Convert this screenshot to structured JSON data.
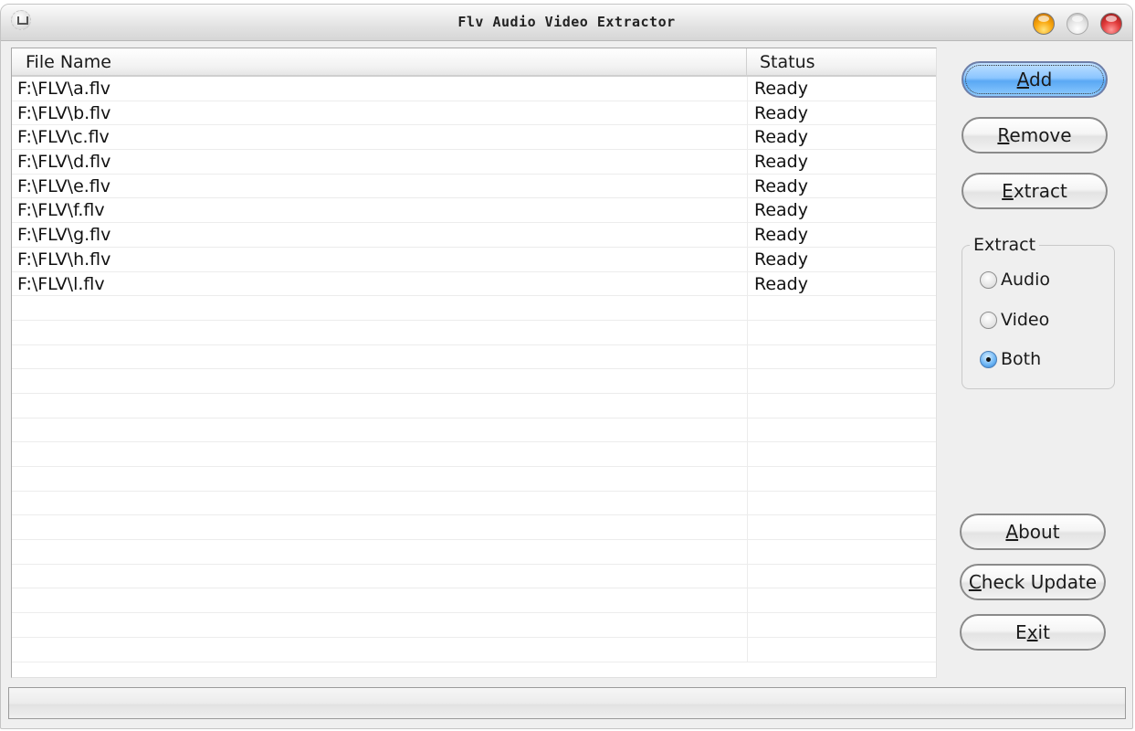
{
  "window": {
    "title": "Flv Audio Video Extractor",
    "icons": {
      "app": "app-icon",
      "minimize": "minimize-icon",
      "maximize": "maximize-icon",
      "close": "close-icon"
    },
    "colors": {
      "minimize": "#f9a70e",
      "maximize": "#e3e3e3",
      "close": "#e23c3c",
      "primary_button": "#8cc6ff"
    }
  },
  "file_list": {
    "columns": [
      "File Name",
      "Status"
    ],
    "rows": [
      {
        "name": "F:\\FLV\\a.flv",
        "status": "Ready"
      },
      {
        "name": "F:\\FLV\\b.flv",
        "status": "Ready"
      },
      {
        "name": "F:\\FLV\\c.flv",
        "status": "Ready"
      },
      {
        "name": "F:\\FLV\\d.flv",
        "status": "Ready"
      },
      {
        "name": "F:\\FLV\\e.flv",
        "status": "Ready"
      },
      {
        "name": "F:\\FLV\\f.flv",
        "status": "Ready"
      },
      {
        "name": "F:\\FLV\\g.flv",
        "status": "Ready"
      },
      {
        "name": "F:\\FLV\\h.flv",
        "status": "Ready"
      },
      {
        "name": "F:\\FLV\\l.flv",
        "status": "Ready"
      }
    ],
    "empty_rows": 15
  },
  "buttons": {
    "add": {
      "mnemonic": "A",
      "rest": "dd"
    },
    "remove": {
      "mnemonic": "R",
      "rest": "emove"
    },
    "extract": {
      "mnemonic": "E",
      "rest": "xtract"
    },
    "about": {
      "mnemonic": "A",
      "rest": "bout"
    },
    "check_update": {
      "mnemonic": "C",
      "rest": "heck Update"
    },
    "exit": {
      "pre": "E",
      "mnemonic": "x",
      "rest": "it"
    }
  },
  "extract_group": {
    "label": "Extract",
    "options": [
      {
        "label": "Audio",
        "checked": false
      },
      {
        "label": "Video",
        "checked": false
      },
      {
        "label": "Both",
        "checked": true
      }
    ]
  },
  "status_bar": {
    "text": ""
  }
}
